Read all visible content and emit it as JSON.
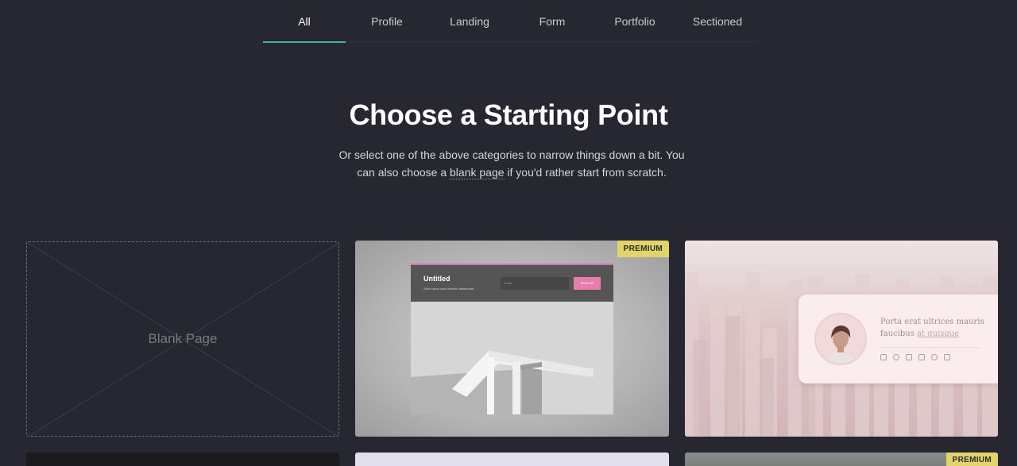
{
  "tabs": [
    {
      "label": "All",
      "active": true
    },
    {
      "label": "Profile",
      "active": false
    },
    {
      "label": "Landing",
      "active": false
    },
    {
      "label": "Form",
      "active": false
    },
    {
      "label": "Portfolio",
      "active": false
    },
    {
      "label": "Sectioned",
      "active": false
    }
  ],
  "heading": {
    "title": "Choose a Starting Point",
    "subtitle_before": "Or select one of the above categories to narrow things down a bit. You can also choose a ",
    "subtitle_link": "blank page",
    "subtitle_after": " if you'd rather start from scratch."
  },
  "cards": {
    "blank": {
      "label": "Blank Page"
    },
    "form_template": {
      "badge": "PREMIUM",
      "window_title": "Untitled",
      "window_desc": "Sem luctus cras lobortis malesuada",
      "email_placeholder": "Email",
      "signup_label": "SIGN UP"
    },
    "profile_template": {
      "text": "Porta erat ultrices mauris faucibus ",
      "link": "at quisque",
      "social_icons": [
        "instagram-icon",
        "pinterest-icon",
        "linkedin-icon",
        "youtube-icon",
        "tiktok-icon",
        "mail-icon"
      ]
    },
    "bottom_right": {
      "badge": "PREMIUM"
    }
  },
  "colors": {
    "background": "#262730",
    "tab_indicator": "#3fb79e",
    "premium_badge": "#e3d36b",
    "signup_button": "#e87dac"
  }
}
